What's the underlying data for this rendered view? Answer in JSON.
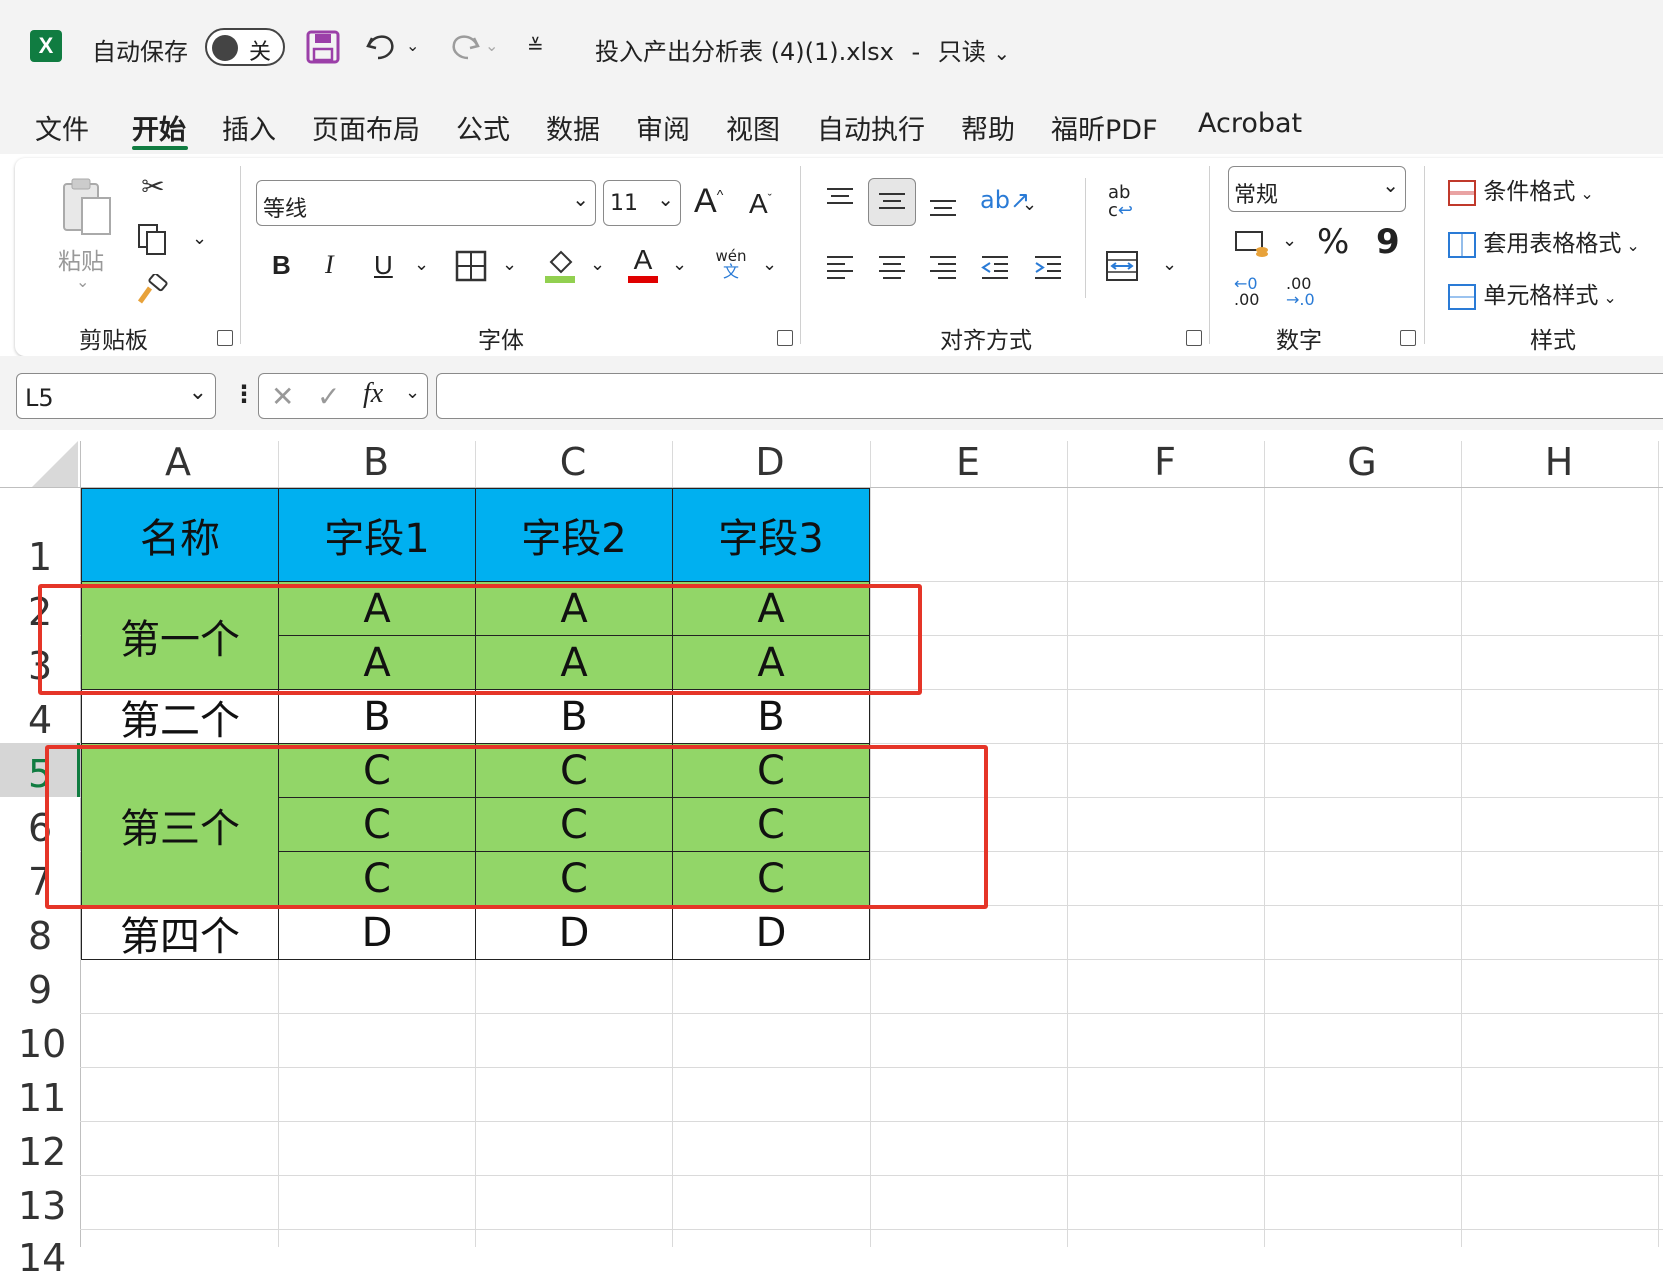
{
  "titlebar": {
    "autosave_label": "自动保存",
    "autosave_state": "关",
    "filename": "投入产出分析表 (4)(1).xlsx",
    "separator": "-",
    "mode": "只读"
  },
  "menu": {
    "tabs": [
      "文件",
      "开始",
      "插入",
      "页面布局",
      "公式",
      "数据",
      "审阅",
      "视图",
      "自动执行",
      "帮助",
      "福昕PDF",
      "Acrobat"
    ],
    "active_tab": "开始"
  },
  "ribbon": {
    "clipboard": {
      "paste_label": "粘贴",
      "group_label": "剪贴板"
    },
    "font": {
      "font_name": "等线",
      "font_size": "11",
      "group_label": "字体",
      "bold": "B",
      "italic": "I",
      "underline": "U",
      "grow": "A",
      "shrink": "A",
      "font_color_letter": "A",
      "phonetic_top": "wén",
      "phonetic_bottom": "文"
    },
    "alignment": {
      "group_label": "对齐方式",
      "wrap_top": "ab",
      "wrap_bottom": "c"
    },
    "number": {
      "format": "常规",
      "group_label": "数字",
      "percent": "%",
      "comma": "9",
      "inc_decimal_top": "←0",
      "inc_decimal_bottom": ".00",
      "dec_decimal_top": ".00",
      "dec_decimal_bottom": "→.0"
    },
    "styles": {
      "conditional": "条件格式",
      "table_format": "套用表格格式",
      "cell_styles": "单元格样式",
      "group_label": "样式"
    }
  },
  "formula_bar": {
    "name_box": "L5",
    "fx_label": "fx",
    "formula": ""
  },
  "grid": {
    "columns": [
      "A",
      "B",
      "C",
      "D",
      "E",
      "F",
      "G",
      "H"
    ],
    "rows": [
      "1",
      "2",
      "3",
      "4",
      "5",
      "6",
      "7",
      "8",
      "9",
      "10",
      "11",
      "12",
      "13",
      "14"
    ],
    "header_cells": [
      "名称",
      "字段1",
      "字段2",
      "字段3"
    ],
    "row_labels": {
      "r2": "第一个",
      "r4": "第二个",
      "r5": "第三个",
      "r8": "第四个"
    },
    "values": {
      "r2": [
        "A",
        "A",
        "A"
      ],
      "r3": [
        "A",
        "A",
        "A"
      ],
      "r4": [
        "B",
        "B",
        "B"
      ],
      "r5": [
        "C",
        "C",
        "C"
      ],
      "r6": [
        "C",
        "C",
        "C"
      ],
      "r7": [
        "C",
        "C",
        "C"
      ],
      "r8": [
        "D",
        "D",
        "D"
      ]
    }
  },
  "colors": {
    "header_fill": "#00b0f0",
    "group_fill": "#92d668",
    "highlight_border": "#e53528",
    "excel_green": "#107c41"
  }
}
